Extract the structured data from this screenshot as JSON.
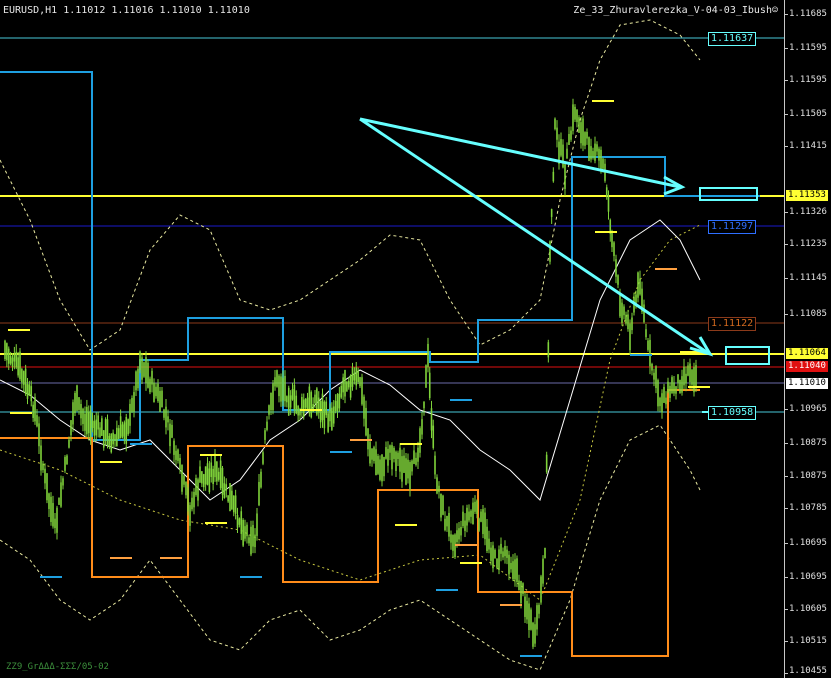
{
  "header": {
    "symbol_info": "EURUSD,H1  1.11012 1.11016 1.11010 1.11010",
    "indicator_name": "Ze_33_Zhuravlerezka_V-04-03_Ibush☺"
  },
  "footer": {
    "zz_label": "ZZ9_GrΔΔΔ-ΣΣΣ/05-02"
  },
  "colors": {
    "background": "#000000",
    "candles": "#7fd33a",
    "blue_channel": "#1e9fe0",
    "orange_channel": "#ff8c1a",
    "yellow_level": "#ffff33",
    "cyan_arrow": "#66ffff",
    "red_level": "#e01010",
    "brown_level": "#8b3a1a"
  },
  "price_axis": {
    "labels": [
      "1.11685",
      "1.11595",
      "1.11505",
      "1.11415",
      "1.11326",
      "1.11235",
      "1.11145",
      "1.11085",
      "1.10965",
      "1.10875",
      "1.10785",
      "1.10695",
      "1.10605",
      "1.10515",
      "1.10455"
    ]
  },
  "axis_tags": [
    {
      "text": "1.11353",
      "bg": "#ffff33",
      "fg": "#000000"
    },
    {
      "text": "1.11064",
      "bg": "#ffff33",
      "fg": "#000000"
    },
    {
      "text": "1.11040",
      "bg": "#e01010",
      "fg": "#ffffff"
    },
    {
      "text": "1.11010",
      "bg": "#ffffff",
      "fg": "#000000"
    }
  ],
  "level_labels": [
    {
      "text": "1.11637",
      "color": "#66ffff"
    },
    {
      "text": "1.11297",
      "color": "#2e6fff"
    },
    {
      "text": "1.11122",
      "color": "#d2691e"
    },
    {
      "text": "1.10958",
      "color": "#66ffff"
    }
  ]
}
